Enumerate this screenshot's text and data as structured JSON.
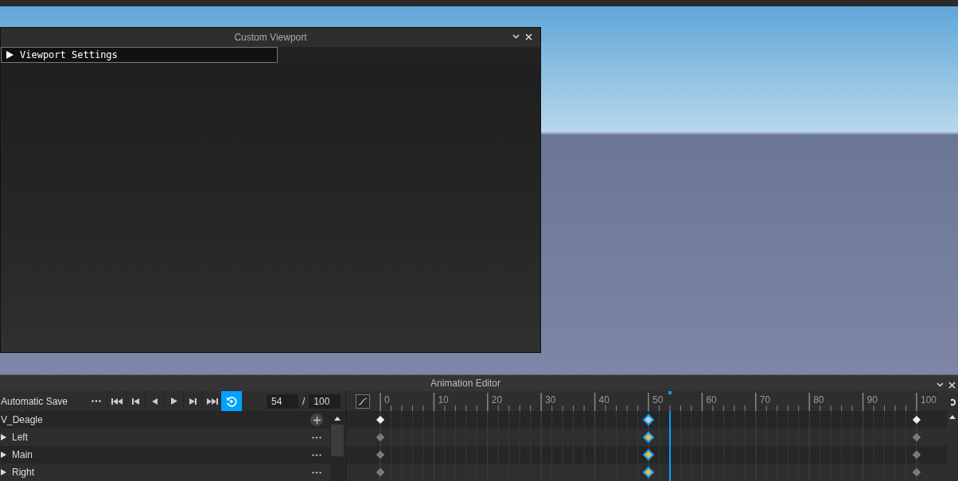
{
  "viewport_window": {
    "title": "Custom Viewport",
    "settings": {
      "label": "Viewport Settings",
      "expanded": false
    }
  },
  "animation_editor": {
    "title": "Animation Editor",
    "save_mode": "Automatic Save",
    "loop": {
      "selected": true
    },
    "current_frame": "54",
    "frame_separator": "/",
    "total_frames": "100",
    "ruler_labels": [
      "0",
      "10",
      "20",
      "30",
      "40",
      "50",
      "60",
      "70",
      "80",
      "90",
      "100"
    ],
    "playhead": {
      "level": 0.54
    },
    "tracks": [
      {
        "name": "V_Deagle",
        "kind": "root",
        "keyframes": [
          {
            "level": 0,
            "selected": false
          },
          {
            "level": 0.5,
            "selected": true
          },
          {
            "level": 1,
            "selected": false
          }
        ]
      },
      {
        "name": "Left",
        "kind": "part",
        "expanded": false,
        "keyframes": [
          {
            "level": 0,
            "selected": false
          },
          {
            "level": 0.5,
            "selected": true
          },
          {
            "level": 1,
            "selected": false
          }
        ]
      },
      {
        "name": "Main",
        "kind": "part",
        "expanded": false,
        "keyframes": [
          {
            "level": 0,
            "selected": false
          },
          {
            "level": 0.5,
            "selected": true
          },
          {
            "level": 1,
            "selected": false
          }
        ]
      },
      {
        "name": "Right",
        "kind": "part",
        "expanded": false,
        "keyframes": [
          {
            "level": 0,
            "selected": false
          },
          {
            "level": 0.5,
            "selected": true
          },
          {
            "level": 1,
            "selected": false
          }
        ]
      }
    ]
  }
}
